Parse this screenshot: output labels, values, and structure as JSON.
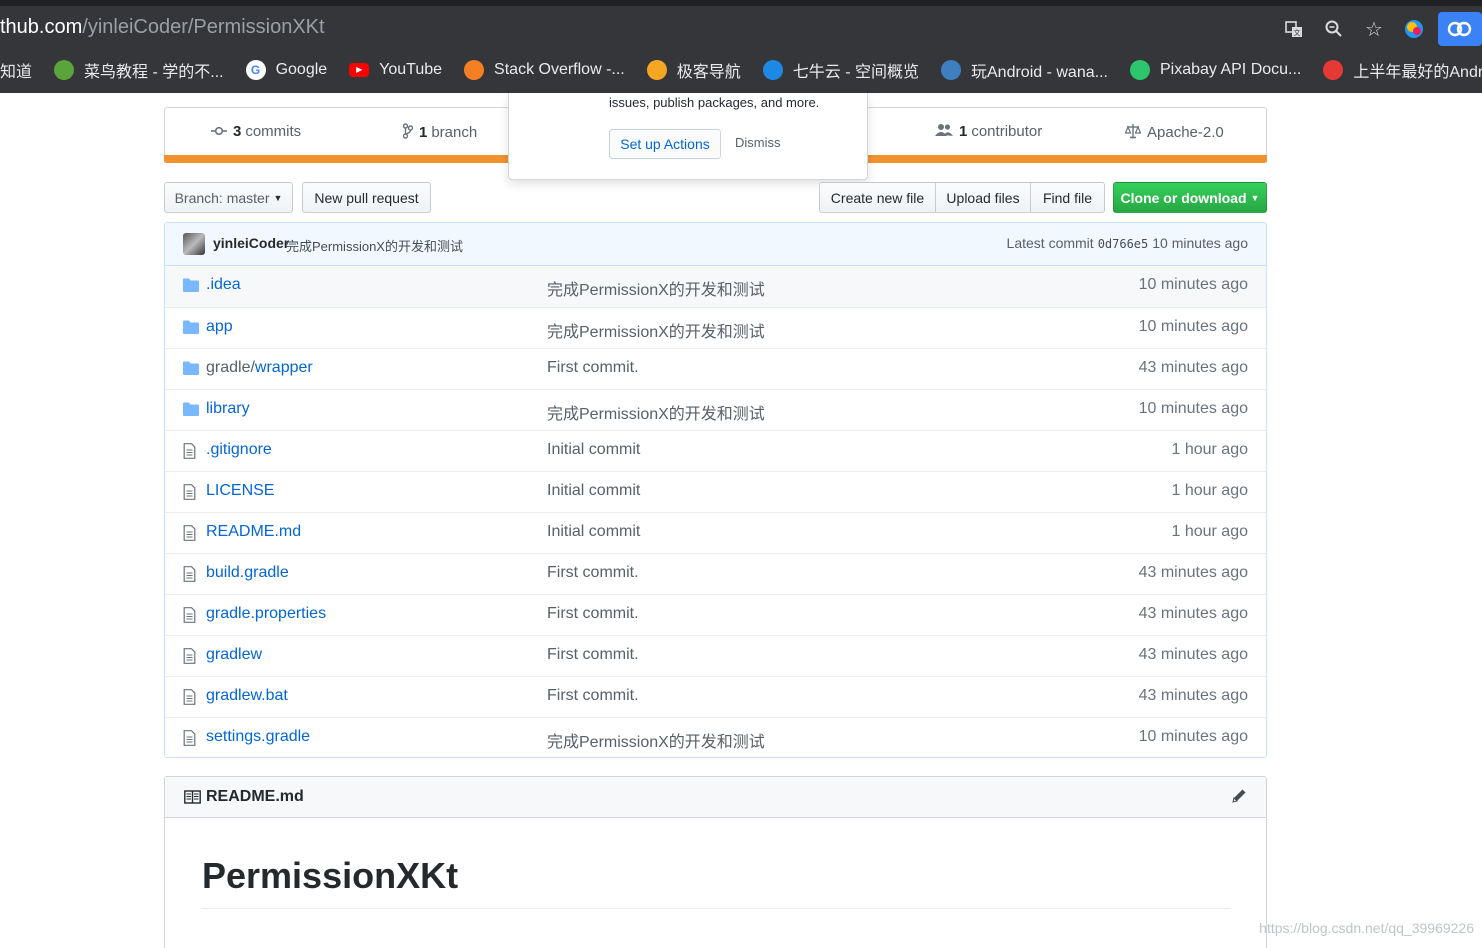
{
  "browser": {
    "url_host": "thub.com",
    "url_path": "/yinleiCoder/PermissionXKt",
    "bookmarks": [
      {
        "label": "知道",
        "icon": "bookmark-icon",
        "color": "#35363a"
      },
      {
        "label": "菜鸟教程 - 学的不...",
        "icon": "runoob-icon",
        "color": "#5ba33b"
      },
      {
        "label": "Google",
        "icon": "google-icon",
        "color": "#ffffff"
      },
      {
        "label": "YouTube",
        "icon": "youtube-icon",
        "color": "#ff0000"
      },
      {
        "label": "Stack Overflow -...",
        "icon": "stackoverflow-icon",
        "color": "#f48024"
      },
      {
        "label": "极客导航",
        "icon": "geek-nav-icon",
        "color": "#f5a623"
      },
      {
        "label": "七牛云 - 空间概览",
        "icon": "qiniu-icon",
        "color": "#1e88e5"
      },
      {
        "label": "玩Android - wana...",
        "icon": "android-icon",
        "color": "#3f7fbf"
      },
      {
        "label": "Pixabay API Docu...",
        "icon": "pixabay-icon",
        "color": "#2ec66d"
      },
      {
        "label": "上半年最好的Andr...",
        "icon": "flame-icon",
        "color": "#e53935"
      }
    ]
  },
  "summary": {
    "commits_count": "3",
    "commits_label": "commits",
    "branch_count": "1",
    "branch_label": "branch",
    "contributor_count": "1",
    "contributor_label": "contributor",
    "license": "Apache-2.0"
  },
  "popover": {
    "text": "issues, publish packages, and more.",
    "setup_label": "Set up Actions",
    "dismiss_label": "Dismiss"
  },
  "toolbar": {
    "branch_label": "Branch: master",
    "new_pr_label": "New pull request",
    "create_file_label": "Create new file",
    "upload_label": "Upload files",
    "find_label": "Find file",
    "clone_label": "Clone or download"
  },
  "latest_commit": {
    "author": "yinleiCoder",
    "message": "完成PermissionX的开发和测试",
    "prefix": "Latest commit",
    "sha": "0d766e5",
    "age": "10 minutes ago"
  },
  "files": [
    {
      "type": "dir",
      "prefix": "",
      "name": ".idea",
      "message": "完成PermissionX的开发和测试",
      "age": "10 minutes ago"
    },
    {
      "type": "dir",
      "prefix": "",
      "name": "app",
      "message": "完成PermissionX的开发和测试",
      "age": "10 minutes ago"
    },
    {
      "type": "dir",
      "prefix": "gradle/",
      "name": "wrapper",
      "message": "First commit.",
      "age": "43 minutes ago"
    },
    {
      "type": "dir",
      "prefix": "",
      "name": "library",
      "message": "完成PermissionX的开发和测试",
      "age": "10 minutes ago"
    },
    {
      "type": "file",
      "prefix": "",
      "name": ".gitignore",
      "message": "Initial commit",
      "age": "1 hour ago"
    },
    {
      "type": "file",
      "prefix": "",
      "name": "LICENSE",
      "message": "Initial commit",
      "age": "1 hour ago"
    },
    {
      "type": "file",
      "prefix": "",
      "name": "README.md",
      "message": "Initial commit",
      "age": "1 hour ago"
    },
    {
      "type": "file",
      "prefix": "",
      "name": "build.gradle",
      "message": "First commit.",
      "age": "43 minutes ago"
    },
    {
      "type": "file",
      "prefix": "",
      "name": "gradle.properties",
      "message": "First commit.",
      "age": "43 minutes ago"
    },
    {
      "type": "file",
      "prefix": "",
      "name": "gradlew",
      "message": "First commit.",
      "age": "43 minutes ago"
    },
    {
      "type": "file",
      "prefix": "",
      "name": "gradlew.bat",
      "message": "First commit.",
      "age": "43 minutes ago"
    },
    {
      "type": "file",
      "prefix": "",
      "name": "settings.gradle",
      "message": "完成PermissionX的开发和测试",
      "age": "10 minutes ago"
    }
  ],
  "readme": {
    "filename": "README.md",
    "heading": "PermissionXKt"
  },
  "watermark": "https://blog.csdn.net/qq_39969226",
  "colors": {
    "accent_link": "#0366d6",
    "language_bar": "#f1922e",
    "clone_button": "#28a745"
  }
}
